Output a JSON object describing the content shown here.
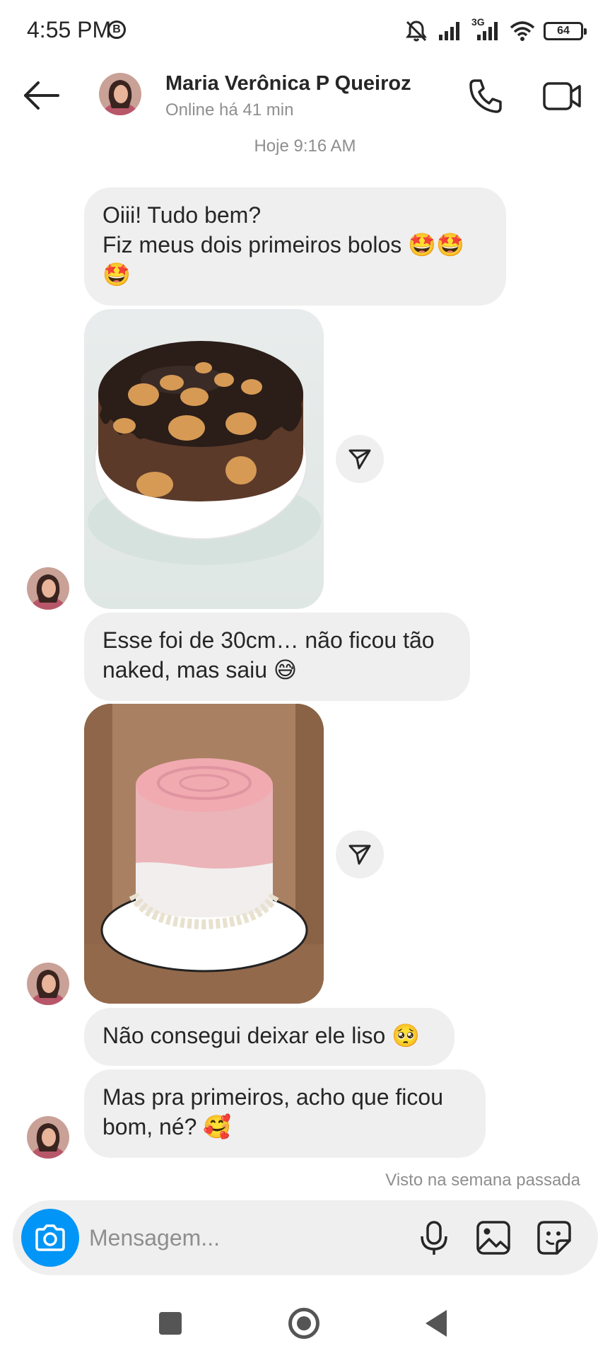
{
  "status_bar": {
    "time": "4:55 PM",
    "b_badge": "B",
    "network": "3G",
    "battery": "64",
    "icons": [
      "mute-icon",
      "signal-icon",
      "signal-3g-icon",
      "wifi-icon",
      "battery-icon"
    ]
  },
  "header": {
    "contact_name": "Maria Verônica P Queiroz",
    "contact_status": "Online há 41 min",
    "icons": [
      "back-arrow-icon",
      "phone-icon",
      "video-camera-icon"
    ]
  },
  "thread": {
    "timestamp": "Hoje 9:16 AM",
    "messages": [
      {
        "type": "text",
        "lines": [
          "Oiii! Tudo bem?",
          "Fiz meus dois primeiros bolos 🤩🤩",
          "🤩"
        ]
      },
      {
        "type": "image",
        "description_icon": "chocolate-cake-photo"
      },
      {
        "type": "text",
        "lines": [
          "Esse foi de 30cm… não ficou tão",
          "naked, mas saiu 😅"
        ]
      },
      {
        "type": "image",
        "description_icon": "pink-cake-photo"
      },
      {
        "type": "text",
        "lines": [
          "Não consegui deixar ele liso 🥺"
        ]
      },
      {
        "type": "text",
        "lines": [
          "Mas pra primeiros, acho que ficou",
          "bom, né? 🥰"
        ]
      }
    ],
    "seen": "Visto na semana passada"
  },
  "composer": {
    "placeholder": "Mensagem...",
    "icons": [
      "camera-icon",
      "microphone-icon",
      "gallery-icon",
      "sticker-icon"
    ]
  },
  "colors": {
    "accent": "#0095f6",
    "bubble": "#efefef",
    "text": "#262626",
    "muted": "#8e8e8e"
  }
}
